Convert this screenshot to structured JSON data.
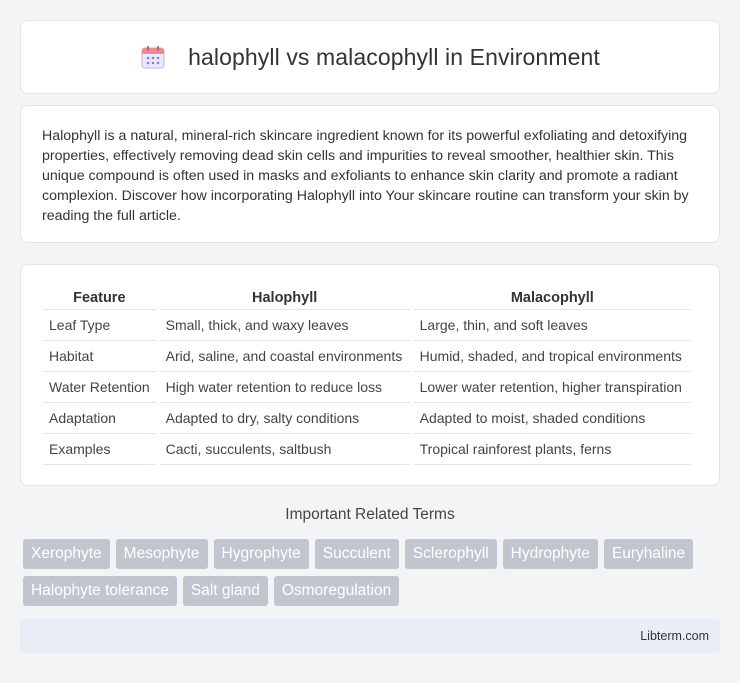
{
  "header": {
    "title": "halophyll vs malacophyll in Environment",
    "icon": "calendar-icon"
  },
  "intro": {
    "text": "Halophyll is a natural, mineral-rich skincare ingredient known for its powerful exfoliating and detoxifying properties, effectively removing dead skin cells and impurities to reveal smoother, healthier skin. This unique compound is often used in masks and exfoliants to enhance skin clarity and promote a radiant complexion. Discover how incorporating Halophyll into Your skincare routine can transform your skin by reading the full article."
  },
  "table": {
    "headers": [
      "Feature",
      "Halophyll",
      "Malacophyll"
    ],
    "rows": [
      [
        "Leaf Type",
        "Small, thick, and waxy leaves",
        "Large, thin, and soft leaves"
      ],
      [
        "Habitat",
        "Arid, saline, and coastal environments",
        "Humid, shaded, and tropical environments"
      ],
      [
        "Water Retention",
        "High water retention to reduce loss",
        "Lower water retention, higher transpiration"
      ],
      [
        "Adaptation",
        "Adapted to dry, salty conditions",
        "Adapted to moist, shaded conditions"
      ],
      [
        "Examples",
        "Cacti, succulents, saltbush",
        "Tropical rainforest plants, ferns"
      ]
    ]
  },
  "related": {
    "title": "Important Related Terms",
    "tags": [
      "Xerophyte",
      "Mesophyte",
      "Hygrophyte",
      "Succulent",
      "Sclerophyll",
      "Hydrophyte",
      "Euryhaline",
      "Halophyte tolerance",
      "Salt gland",
      "Osmoregulation"
    ]
  },
  "footer": {
    "text": "Libterm.com"
  },
  "colors": {
    "tag_bg": "#c1c6ce",
    "footer_bg": "#e8edf6",
    "icon_accent": "#8b7fd6"
  }
}
